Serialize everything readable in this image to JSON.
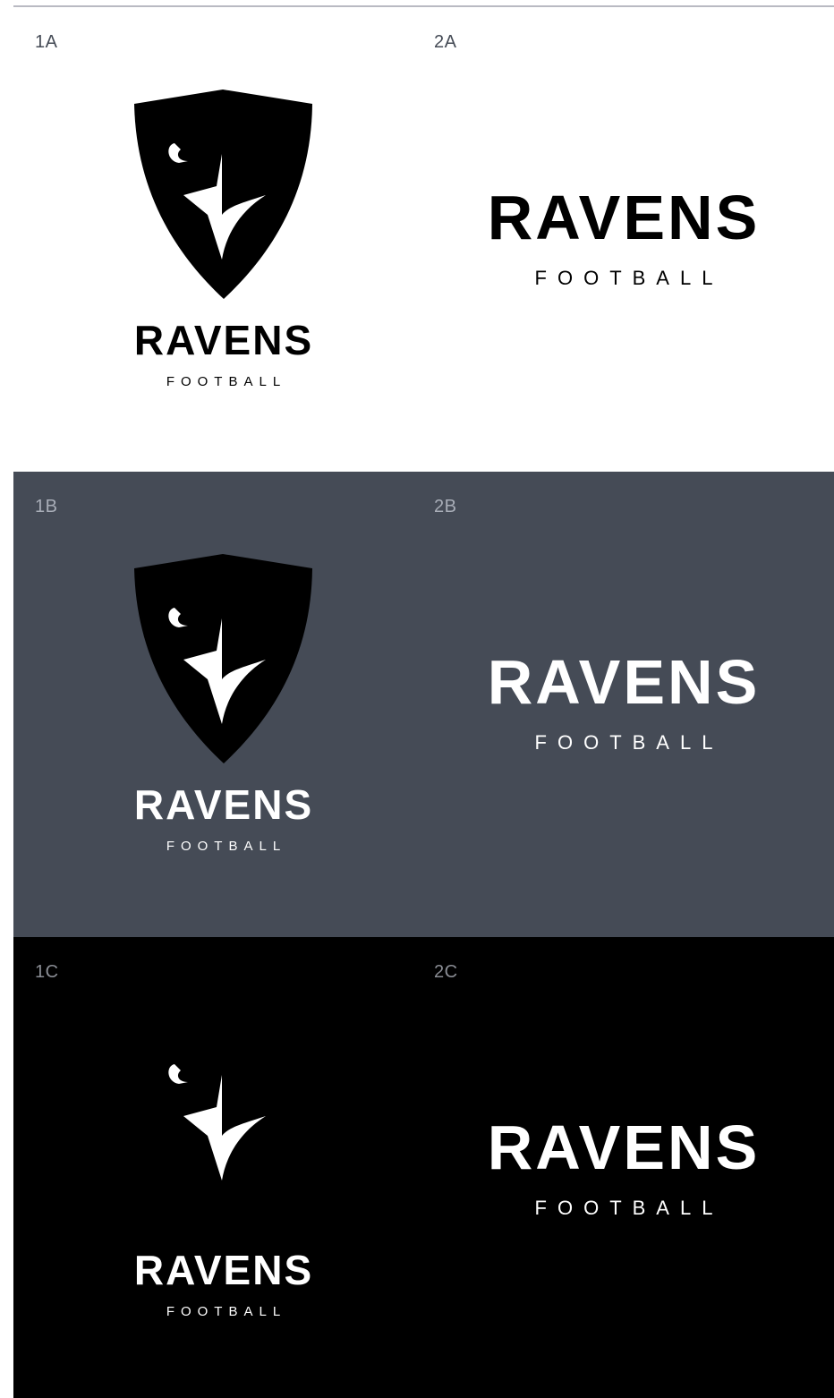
{
  "panels": [
    {
      "id": "a",
      "left": {
        "code": "1A",
        "wordmark": "RAVENS",
        "subtitle": "FOOTBALL"
      },
      "right": {
        "code": "2A",
        "wordmark": "RAVENS",
        "subtitle": "FOOTBALL"
      },
      "background": "#ffffff",
      "text_color": "#000000"
    },
    {
      "id": "b",
      "left": {
        "code": "1B",
        "wordmark": "RAVENS",
        "subtitle": "FOOTBALL"
      },
      "right": {
        "code": "2B",
        "wordmark": "RAVENS",
        "subtitle": "FOOTBALL"
      },
      "background": "#454b56",
      "text_color": "#ffffff"
    },
    {
      "id": "c",
      "left": {
        "code": "1C",
        "wordmark": "RAVENS",
        "subtitle": "FOOTBALL"
      },
      "right": {
        "code": "2C",
        "wordmark": "RAVENS",
        "subtitle": "FOOTBALL"
      },
      "background": "#000000",
      "text_color": "#ffffff"
    }
  ],
  "icons": {
    "crest": "shield-icon",
    "emblem": "raven-icon"
  }
}
